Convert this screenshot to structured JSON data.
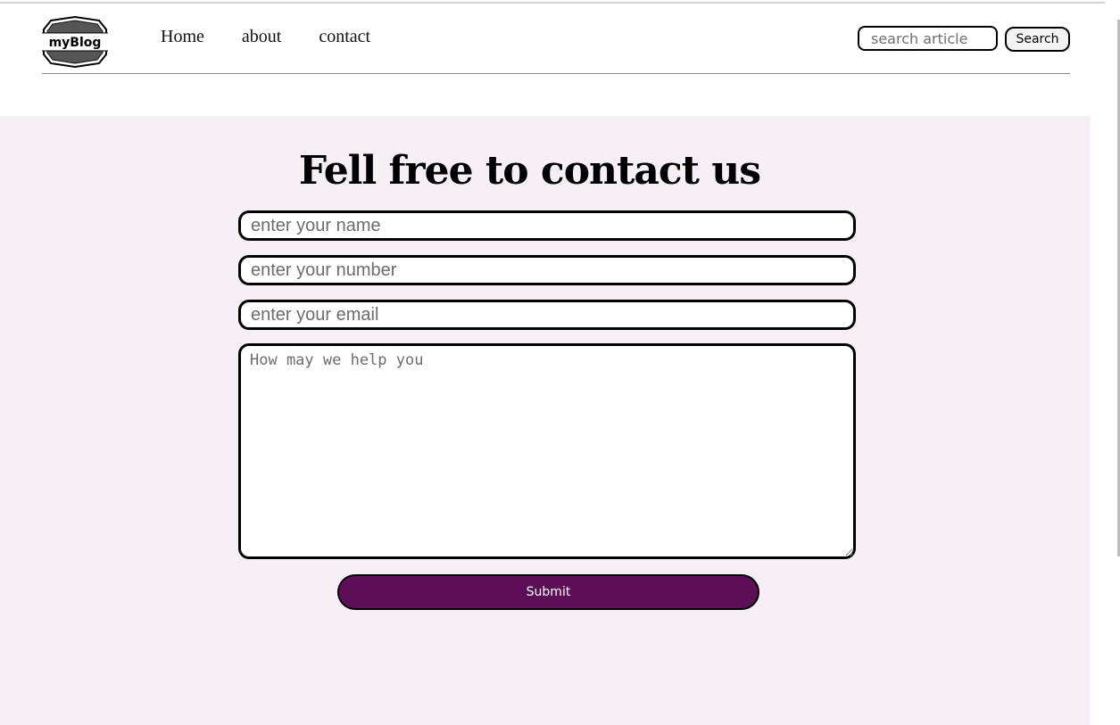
{
  "header": {
    "logo_text": "myBlog",
    "nav": [
      {
        "label": "Home"
      },
      {
        "label": "about"
      },
      {
        "label": "contact"
      }
    ],
    "search": {
      "placeholder": "search article",
      "button_label": "Search"
    }
  },
  "contact": {
    "title": "Fell free to contact us",
    "name_placeholder": "enter your name",
    "number_placeholder": "enter your number",
    "email_placeholder": "enter your email",
    "message_placeholder": "How may we help you",
    "submit_label": "Submit"
  },
  "colors": {
    "accent": "#5c0f58",
    "section_background": "#f7eff6"
  }
}
